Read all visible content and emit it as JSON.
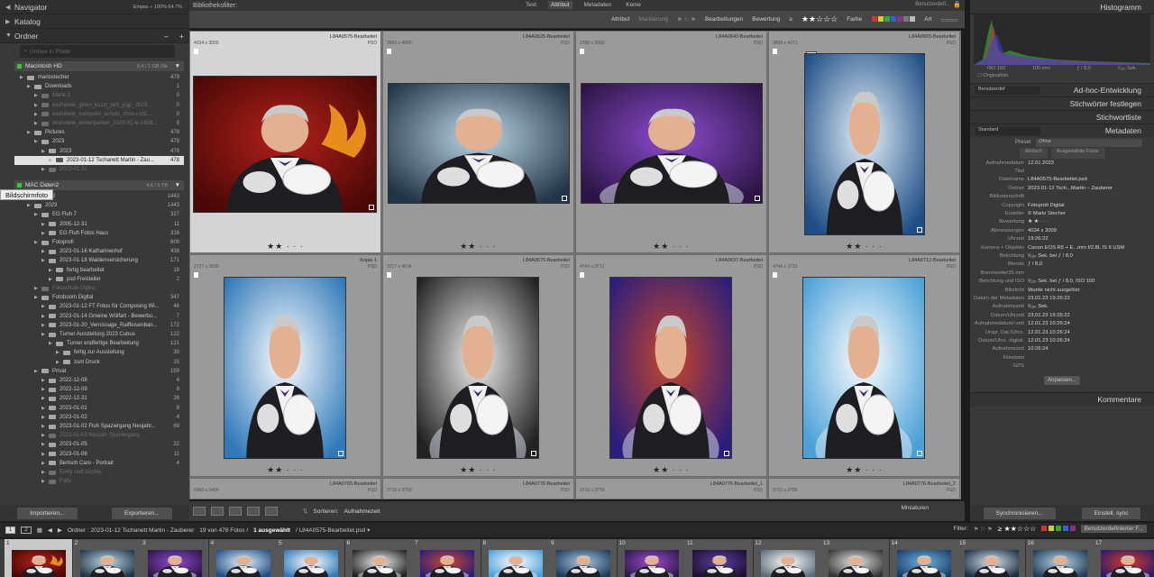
{
  "left_panel": {
    "navigator": "Navigator",
    "navigator_fit": "Einpas ÷",
    "navigator_z1": "100%",
    "navigator_z2": "64.7%",
    "catalog": "Katalog",
    "folders": "Ordner",
    "folder_plus": "+",
    "folder_minus": "–",
    "search_placeholder": "Ordner in Pfade",
    "volume1": {
      "name": "Macintosh HD",
      "size": "9,4 / 1 GB Stk"
    },
    "volume2": {
      "name": "MAC Daten2",
      "size": "4,6 / 5 TB"
    },
    "tooltip": "Bildschirmfoto",
    "import_btn": "Importieren...",
    "export_btn": "Exportieren..."
  },
  "folders1": [
    {
      "label": "mariostecher",
      "count": "479",
      "dim": false
    },
    {
      "label": "Downloads",
      "count": "1",
      "dim": false
    },
    {
      "label": "Marie 2",
      "count": "0",
      "dim": true
    },
    {
      "label": "weinwelle_ginko_kuzel_jdrit_jcgp_2023...",
      "count": "0",
      "dim": true
    },
    {
      "label": "weinwelle_trampolin_schule_chris-r-ct2...",
      "count": "0",
      "dim": true
    },
    {
      "label": "weinwelle_einkerpartien_2023-01-le-1608...",
      "count": "0",
      "dim": true
    },
    {
      "label": "Pictures",
      "count": "478",
      "dim": false
    },
    {
      "label": "2023",
      "count": "478",
      "dim": false
    },
    {
      "label": "2023",
      "count": "478",
      "dim": false
    },
    {
      "label": "2023-01-12 Tschanett Martin - Zau...",
      "count": "478",
      "dim": false,
      "sel": true
    },
    {
      "label": "2023-01-31",
      "count": "",
      "dim": true
    }
  ],
  "folders2": [
    {
      "label": "Daten2",
      "count": "1443"
    },
    {
      "label": "2023",
      "count": "1443"
    },
    {
      "label": "EG Fluh 7",
      "count": "327"
    },
    {
      "label": "2005-12-31",
      "count": "11"
    },
    {
      "label": "EG Fluh Fotos Haus",
      "count": "316"
    },
    {
      "label": "Fotoprofi",
      "count": "609"
    },
    {
      "label": "2023-01-16 Katharinenhof",
      "count": "438"
    },
    {
      "label": "2023-01-18 Waldenversicherung",
      "count": "171"
    },
    {
      "label": "fertig bearbeitet",
      "count": "18"
    },
    {
      "label": "psd Freisteller",
      "count": "2"
    },
    {
      "label": "Fotoschule Digital",
      "count": "",
      "dim": true
    },
    {
      "label": "Fotoboom Digital",
      "count": "347"
    },
    {
      "label": "2023-01-12 FT Fotos für Composing Wi...",
      "count": "46"
    },
    {
      "label": "2023-01-14 Gmeine Wölfart - Bewerbu...",
      "count": "7"
    },
    {
      "label": "2023-01-20_Vernissage_Raiffeisenban...",
      "count": "172"
    },
    {
      "label": "Turner Ausstellung 2023 Cubus",
      "count": "122"
    },
    {
      "label": "Turner endfertige Bearbeitung",
      "count": "121"
    },
    {
      "label": "fertig zur Ausstellung",
      "count": "30"
    },
    {
      "label": "zum Druck",
      "count": "25"
    },
    {
      "label": "Privat",
      "count": "159"
    },
    {
      "label": "2022-12-08",
      "count": "4"
    },
    {
      "label": "2022-12-09",
      "count": "8"
    },
    {
      "label": "2022-12-31",
      "count": "26"
    },
    {
      "label": "2023-01-01",
      "count": "8"
    },
    {
      "label": "2023-01-02",
      "count": "4"
    },
    {
      "label": "2023-01-02 Fluh Spaziergang Neujahr...",
      "count": "69"
    },
    {
      "label": "2023-01-03 Neujahr Spaziergang",
      "count": "",
      "dim": true
    },
    {
      "label": "2023-01-05",
      "count": "22"
    },
    {
      "label": "2023-01-06",
      "count": "11"
    },
    {
      "label": "Bertsch Caro - Portrait",
      "count": "4"
    },
    {
      "label": "Emily und Sophie",
      "count": "",
      "dim": true
    },
    {
      "label": "Fotis",
      "count": "",
      "dim": true
    }
  ],
  "center": {
    "title": "Bibliotheksfilter:",
    "tabs": [
      "Text",
      "Attribut",
      "Metadaten",
      "Keine"
    ],
    "preset": "Benutzerdefi...",
    "filter_attr": "Attribut",
    "filter_mark": "Markierung",
    "filter_edit": "Bearbeitungen",
    "filter_rating": "Bewertung",
    "rating_op": "≥",
    "filter_color": "Farbe",
    "filter_type": "Art",
    "sort_label": "Sortieren:",
    "sort_value": "Aufnahmezeit",
    "minis": "Miniaturen"
  },
  "grid": [
    {
      "name": "L84A0575-Bearbeitet",
      "dim": "4034 x 3009",
      "ext": "PSD",
      "stars": "★★ · · ·",
      "sel": true
    },
    {
      "name": "L84A0625-Bearbeitet",
      "dim": "3600 x 4000",
      "ext": "PSD",
      "stars": "★★ · · ·"
    },
    {
      "name": "L84A0643-Bearbeitet",
      "dim": "3780 x 3009",
      "ext": "PSD",
      "stars": "★★ · · ·"
    },
    {
      "name": "L84A0665-Bearbeitet",
      "dim": "2899 x 4371",
      "ext": "PSD",
      "stars": "★★ · · ·",
      "stack": "2"
    },
    {
      "name": "Kopie 1",
      "dim": "2727 x 3600",
      "ext": "PSD",
      "stars": "★★ · · ·"
    },
    {
      "name": "L84A0675-Bearbeitet",
      "dim": "3217 x 4034",
      "ext": "PSD",
      "stars": "★★ · · ·"
    },
    {
      "name": "L84A0697-Bearbeitet",
      "dim": "4744 x 3712",
      "ext": "PSD",
      "stars": "★★ · · ·"
    },
    {
      "name": "L84A0712-Bearbeitet",
      "dim": "4744 x 3712",
      "ext": "PSD",
      "stars": "★★ · · ·"
    },
    {
      "name": "L84A0765-Bearbeitet",
      "dim": "6960 x 5464",
      "ext": "PSD"
    },
    {
      "name": "L84A0776-Bearbeitet",
      "dim": "3710 x 3759",
      "ext": "PSD"
    },
    {
      "name": "L84A0776-Bearbeitet_1",
      "dim": "3710 x 3759",
      "ext": "PSD"
    },
    {
      "name": "L84A0776-Bearbeitet_2",
      "dim": "3710 x 3759",
      "ext": "PSD"
    }
  ],
  "right_panel": {
    "histogram": "Histogramm",
    "iso": "ISO 160",
    "focal": "100 mm",
    "aperture": "ƒ / 8,0",
    "shutter": "¹⁄₁₆₀ Sek.",
    "original": "Originalfoto",
    "adhoc_preset": "Benutzerdef",
    "adhoc": "Ad-hoc-Entwicklung",
    "keywords_set": "Stichwörter festlegen",
    "keywords_list": "Stichwortliste",
    "metadata": "Metadaten",
    "metadata_preset": "Standard",
    "preset_label": "Preset",
    "preset_value": "Ohne",
    "tab1": "Einfach",
    "tab2": "Ausgewählte Fotos",
    "apply": "Anpassen...",
    "comments": "Kommentare",
    "sync_btn": "Synchronisieren...",
    "sync_btn2": "Einstell. sync"
  },
  "metadata": [
    {
      "k": "Aufnahmedatum",
      "v": "12.01.2023"
    },
    {
      "k": "Titel",
      "v": ""
    },
    {
      "k": "Dateiname",
      "v": "L84A0575-Bearbeitet.psd"
    },
    {
      "k": "Ordner",
      "v": "2023-01-12 Tsch...Martin – Zauberer"
    },
    {
      "k": "Bildunterschrift",
      "v": ""
    },
    {
      "k": "Copyright",
      "v": "Fotoprofi Digital"
    },
    {
      "k": "Ersteller",
      "v": "© Mario Stecher"
    },
    {
      "k": "Bewertung",
      "v": "★ ★ · · ·"
    },
    {
      "k": "Abmessungen",
      "v": "4034 x 3009"
    },
    {
      "k": "Uhrzeit",
      "v": "19:26:22"
    },
    {
      "k": "Kamera + Objektiv",
      "v": "Canon EOS R5 + E...mm f/2.8L IS II USM"
    },
    {
      "k": "Belichtung",
      "v": "¹⁄₁₆₀ Sek. bei ƒ / 8,0"
    },
    {
      "k": "Blende",
      "v": "ƒ / 8,0"
    },
    {
      "k": "Brennweite/35 mm",
      "v": ""
    },
    {
      "k": "Belichtung und ISO",
      "v": "¹⁄₁₆₀ Sek. bei ƒ / 8,0, ISO 160"
    },
    {
      "k": "Blitzlicht",
      "v": "Wurde nicht ausgelöst"
    },
    {
      "k": "Datum der Metadaten",
      "v": "23.01.23 19:26:22"
    },
    {
      "k": "Aufnahmezeit",
      "v": "¹⁄₁₆₀ Sek."
    },
    {
      "k": "Datum/Uhrzeit",
      "v": "23.01.23 19:26:22"
    },
    {
      "k": "Aufnahmedatum/-zeit",
      "v": "12.01.23 10:26:24"
    },
    {
      "k": "Urspr. Dat./Uhrz.",
      "v": "12.01.23 10:26:24"
    },
    {
      "k": "Datum/Uhrz. digital.",
      "v": "12.01.23 10:26:24"
    },
    {
      "k": "Aufnahmezeit",
      "v": "10:26:24"
    },
    {
      "k": "Filmdatei",
      "v": ""
    },
    {
      "k": "GPS",
      "v": ""
    }
  ],
  "status": {
    "page1": "1",
    "page2": "2",
    "path": "Ordner : 2023-01-12 Tschanett Martin - Zauberer",
    "count": "19 von 478 Fotos /",
    "selected": "1 ausgewählt",
    "file": "/ L84A0575-Bearbeitet.psd ▾",
    "filter": "Filter:",
    "custom": "Benutzerdefinierter F..."
  },
  "filmstrip": [
    "1",
    "2",
    "3",
    "4",
    "5",
    "6",
    "7",
    "8",
    "9",
    "10",
    "11",
    "12",
    "13",
    "14",
    "15",
    "16",
    "17"
  ],
  "colors": {
    "accent": "#3ec43e",
    "selected": "#e1e1e1",
    "panel": "#393939"
  }
}
